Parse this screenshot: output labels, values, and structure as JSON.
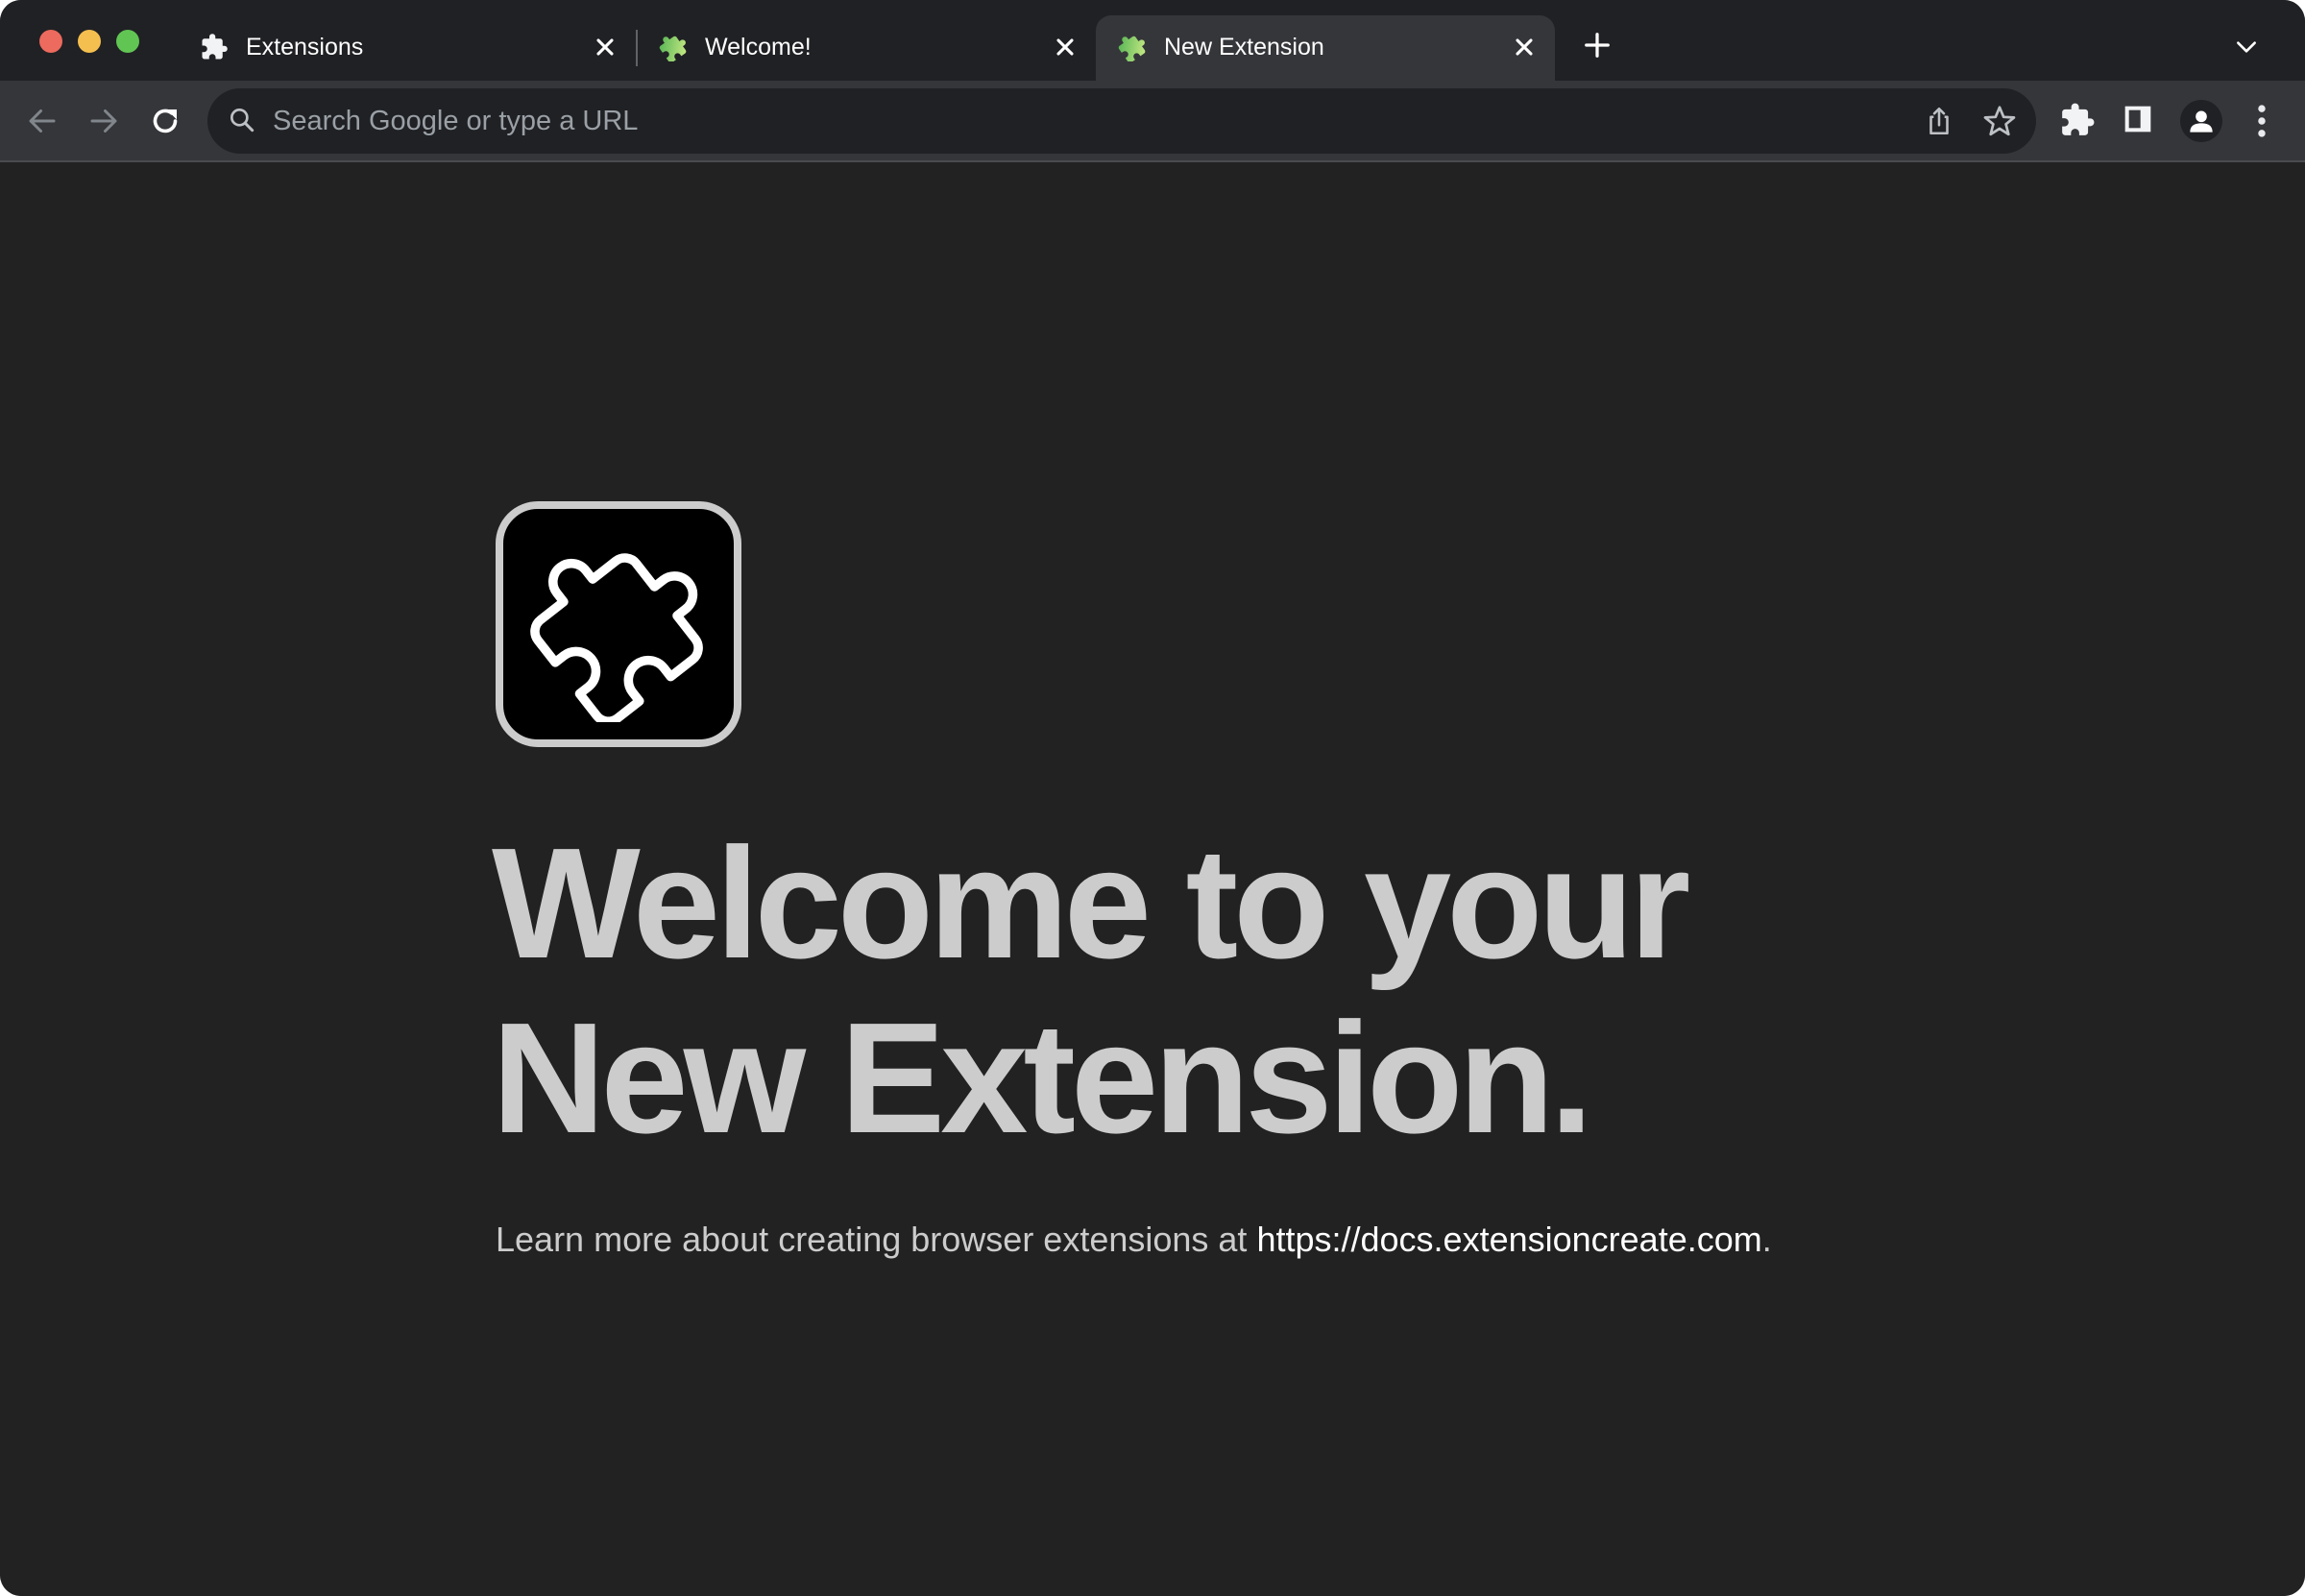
{
  "window": {
    "controls": [
      "close",
      "minimize",
      "maximize"
    ]
  },
  "tabs": [
    {
      "title": "Extensions",
      "favicon": "puzzle-icon-white",
      "active": false
    },
    {
      "title": "Welcome!",
      "favicon": "puzzle-icon-green",
      "active": false
    },
    {
      "title": "New Extension",
      "favicon": "puzzle-icon-green",
      "active": true
    }
  ],
  "toolbar": {
    "omnibox_placeholder": "Search Google or type a URL",
    "omnibox_value": "",
    "icons": [
      "back-icon",
      "forward-icon",
      "reload-icon",
      "search-icon",
      "share-icon",
      "star-icon",
      "extensions-icon",
      "side-panel-icon",
      "profile-icon",
      "menu-icon"
    ]
  },
  "page": {
    "hero_icon": "puzzle-icon",
    "headline_line1": "Welcome to your",
    "headline_line2": "New Extension.",
    "subtitle_prefix": "Learn more about creating browser extensions at ",
    "subtitle_link": "https://docs.extensioncreate.com",
    "subtitle_suffix": "."
  },
  "colors": {
    "tabstrip_bg": "#202124",
    "toolbar_bg": "#35363a",
    "page_bg": "#222222",
    "headline": "#cccccc",
    "link": "#ffffff"
  }
}
